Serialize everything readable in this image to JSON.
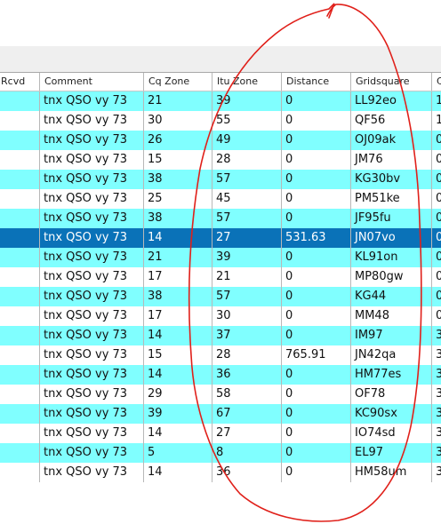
{
  "table": {
    "columns": [
      "Rcvd",
      "Comment",
      "Cq Zone",
      "Itu Zone",
      "Distance",
      "Gridsquare",
      "C"
    ],
    "rows": [
      {
        "rcvd": "",
        "comment": "tnx QSO vy 73",
        "cq": "21",
        "itu": "39",
        "dist": "0",
        "grid": "LL92eo",
        "c": "1",
        "style": "cyan"
      },
      {
        "rcvd": "",
        "comment": "tnx QSO vy 73",
        "cq": "30",
        "itu": "55",
        "dist": "0",
        "grid": "QF56",
        "c": "1",
        "style": "white"
      },
      {
        "rcvd": "",
        "comment": "tnx QSO vy 73",
        "cq": "26",
        "itu": "49",
        "dist": "0",
        "grid": "OJ09ak",
        "c": "0",
        "style": "cyan"
      },
      {
        "rcvd": "",
        "comment": "tnx QSO vy 73",
        "cq": "15",
        "itu": "28",
        "dist": "0",
        "grid": "JM76",
        "c": "0",
        "style": "white"
      },
      {
        "rcvd": "",
        "comment": "tnx QSO vy 73",
        "cq": "38",
        "itu": "57",
        "dist": "0",
        "grid": "KG30bv",
        "c": "0",
        "style": "cyan"
      },
      {
        "rcvd": "",
        "comment": "tnx QSO vy 73",
        "cq": "25",
        "itu": "45",
        "dist": "0",
        "grid": "PM51ke",
        "c": "0",
        "style": "white"
      },
      {
        "rcvd": "",
        "comment": "tnx QSO vy 73",
        "cq": "38",
        "itu": "57",
        "dist": "0",
        "grid": "JF95fu",
        "c": "0",
        "style": "cyan"
      },
      {
        "rcvd": "",
        "comment": "tnx QSO vy 73",
        "cq": "14",
        "itu": "27",
        "dist": "531.63",
        "grid": "JN07vo",
        "c": "0",
        "style": "sel"
      },
      {
        "rcvd": "",
        "comment": "tnx QSO vy 73",
        "cq": "21",
        "itu": "39",
        "dist": "0",
        "grid": "KL91on",
        "c": "0",
        "style": "cyan"
      },
      {
        "rcvd": "",
        "comment": "tnx QSO vy 73",
        "cq": "17",
        "itu": "21",
        "dist": "0",
        "grid": "MP80gw",
        "c": "0",
        "style": "white"
      },
      {
        "rcvd": "",
        "comment": "tnx QSO vy 73",
        "cq": "38",
        "itu": "57",
        "dist": "0",
        "grid": "KG44",
        "c": "0",
        "style": "cyan"
      },
      {
        "rcvd": "",
        "comment": "tnx QSO vy 73",
        "cq": "17",
        "itu": "30",
        "dist": "0",
        "grid": "MM48",
        "c": "0",
        "style": "white"
      },
      {
        "rcvd": "",
        "comment": "tnx QSO vy 73",
        "cq": "14",
        "itu": "37",
        "dist": "0",
        "grid": "IM97",
        "c": "3",
        "style": "cyan"
      },
      {
        "rcvd": "",
        "comment": "tnx QSO vy 73",
        "cq": "15",
        "itu": "28",
        "dist": "765.91",
        "grid": "JN42qa",
        "c": "3",
        "style": "white"
      },
      {
        "rcvd": "",
        "comment": "tnx QSO vy 73",
        "cq": "14",
        "itu": "36",
        "dist": "0",
        "grid": "HM77es",
        "c": "3",
        "style": "cyan"
      },
      {
        "rcvd": "",
        "comment": "tnx QSO vy 73",
        "cq": "29",
        "itu": "58",
        "dist": "0",
        "grid": "OF78",
        "c": "3",
        "style": "white"
      },
      {
        "rcvd": "",
        "comment": "tnx QSO vy 73",
        "cq": "39",
        "itu": "67",
        "dist": "0",
        "grid": "KC90sx",
        "c": "3",
        "style": "cyan"
      },
      {
        "rcvd": "",
        "comment": "tnx QSO vy 73",
        "cq": "14",
        "itu": "27",
        "dist": "0",
        "grid": "IO74sd",
        "c": "3",
        "style": "white"
      },
      {
        "rcvd": "",
        "comment": "tnx QSO vy 73",
        "cq": "5",
        "itu": "8",
        "dist": "0",
        "grid": "EL97",
        "c": "3",
        "style": "cyan"
      },
      {
        "rcvd": "",
        "comment": "tnx QSO vy 73",
        "cq": "14",
        "itu": "36",
        "dist": "0",
        "grid": "HM58um",
        "c": "3",
        "style": "white"
      }
    ]
  },
  "colors": {
    "row_cyan": "#80ffff",
    "row_white": "#ffffff",
    "row_selected": "#0a72b8",
    "annotation_ink": "#e0201a"
  },
  "annotation": {
    "shape": "hand-drawn loop",
    "color": "#e0201a"
  }
}
